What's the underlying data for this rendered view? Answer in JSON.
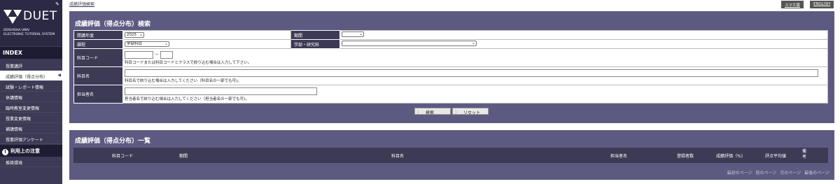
{
  "sidebar": {
    "logo_word": "DUET",
    "logo_sub_1": "DOSHISHA UNIV",
    "logo_sub_2": "ELECTRONIC TUTORIAL SYSTEM",
    "index_label": "INDEX",
    "items": [
      {
        "label": "授業講評"
      },
      {
        "label": "成績評価（得点分布）"
      },
      {
        "label": "試験・レポート情報"
      },
      {
        "label": "休講情報"
      },
      {
        "label": "臨時教室変更情報"
      },
      {
        "label": "授業変更情報"
      },
      {
        "label": "補講情報"
      },
      {
        "label": "授業評価アンケート"
      }
    ],
    "notice_label": "利用上の注意",
    "env_label": "推奨環境"
  },
  "header": {
    "breadcrumb": "成績評価検索",
    "smartphone_label": "スマホ版",
    "english_label": "ENGLISH"
  },
  "search": {
    "title": "成績評価（得点分布）検索",
    "year_label": "開講年度",
    "year_value": "2025",
    "period_label": "期間",
    "period_value": "",
    "course_label": "課程",
    "course_value": "学部科目",
    "faculty_label": "学部・研究科",
    "faculty_value": "",
    "code_label": "科目コード",
    "code_sep": "－",
    "code_hint": "科目コードまたは科目コードとクラスで絞り込む場合は入力して下さい。",
    "name_label": "科目名",
    "name_hint": "科目名で絞り込む場合は入力してください（科目名の一部でも可)。",
    "teacher_label": "担当者名",
    "teacher_hint": "担当者名で絞り込む場合は入力してください（担当者名の一部でも可)。",
    "search_button": "検索",
    "reset_button": "リセット"
  },
  "results": {
    "title": "成績評価（得点分布）一覧",
    "columns": [
      "科目コード",
      "期間",
      "科目名",
      "担当者名",
      "登録者数",
      "成績評価（%)",
      "評点平均値",
      "備考"
    ],
    "pager": [
      "最初のページ",
      "前のページ",
      "次のページ",
      "最後のページ"
    ]
  }
}
